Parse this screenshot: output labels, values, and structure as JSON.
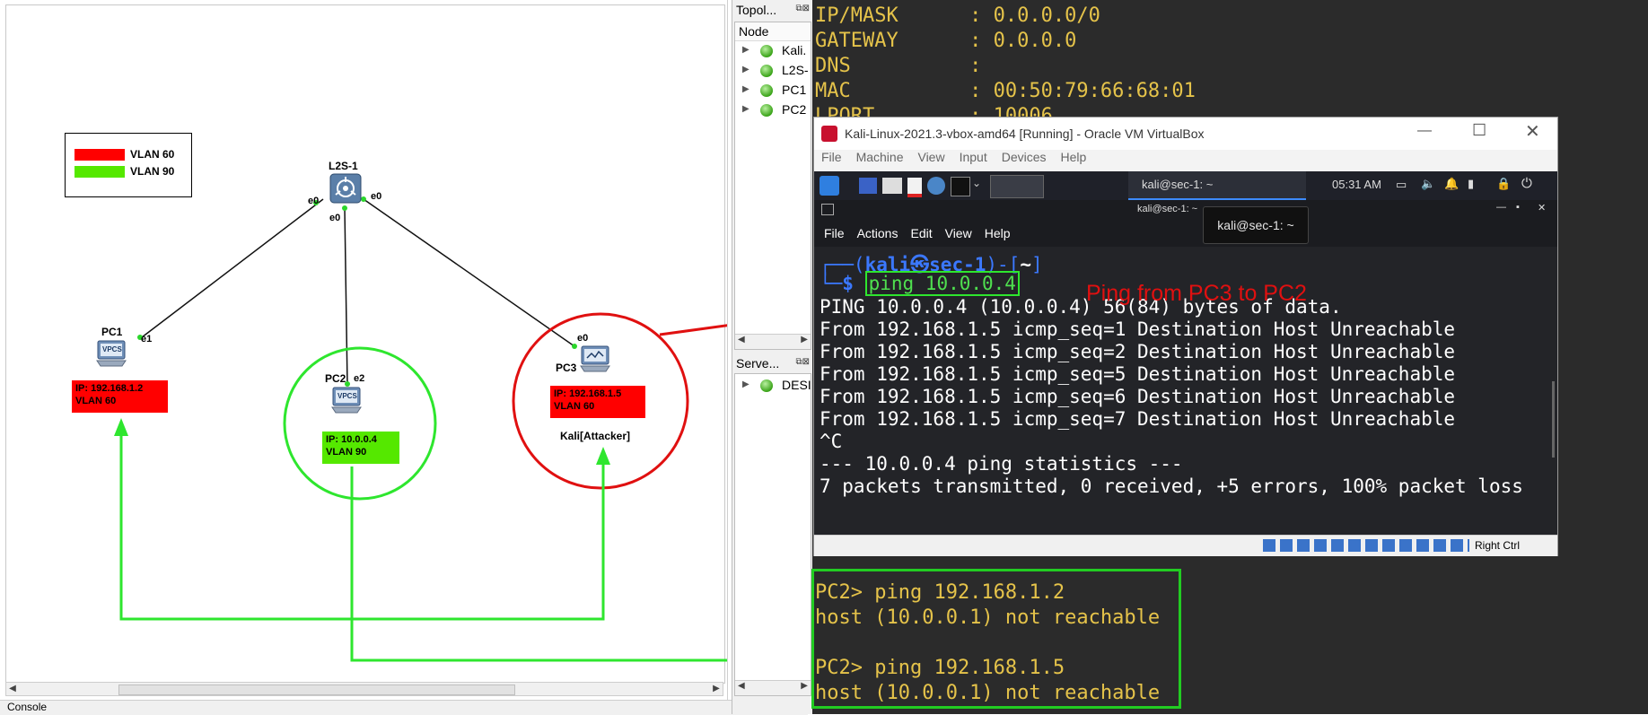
{
  "legend": [
    {
      "label": "VLAN 60",
      "color": "#ff0000"
    },
    {
      "label": "VLAN 90",
      "color": "#55e800"
    }
  ],
  "switch": {
    "name": "L2S-1",
    "ports": [
      "e0",
      "e0",
      "e0"
    ]
  },
  "pc1": {
    "name": "PC1",
    "port": "e1",
    "ip": "IP: 192.168.1.2",
    "vlan": "VLAN 60"
  },
  "pc2": {
    "name": "PC2",
    "port": "e2",
    "ip": "IP: 10.0.0.4",
    "vlan": "VLAN 90"
  },
  "pc3": {
    "name": "PC3",
    "port": "e0",
    "ip": "IP: 192.168.1.5",
    "vlan": "VLAN 60",
    "caption": "Kali[Attacker]"
  },
  "vpcs_label": "VPCS",
  "side": {
    "topology_title": "Topol...",
    "tree_header": "Node",
    "nodes": [
      "Kali.",
      "L2S-",
      "PC1",
      "PC2"
    ],
    "servers_title": "Serve...",
    "servers": [
      "DESI"
    ]
  },
  "console_label": "Console",
  "top_terminal": [
    "IP/MASK      : 0.0.0.0/0",
    "GATEWAY      : 0.0.0.0",
    "DNS          :",
    "MAC          : 00:50:79:66:68:01",
    "LPORT        : 10006"
  ],
  "vbox": {
    "title": "Kali-Linux-2021.3-vbox-amd64 [Running] - Oracle VM VirtualBox",
    "menu": [
      "File",
      "Machine",
      "View",
      "Input",
      "Devices",
      "Help"
    ],
    "task_title": "kali@sec-1: ~",
    "clock": "05:31 AM",
    "guest_title": "kali@sec-1: ~",
    "guest_menu": [
      "File",
      "Actions",
      "Edit",
      "View",
      "Help"
    ],
    "tooltip": "kali@sec-1: ~",
    "prompt_user": "kali",
    "prompt_host": "sec-1",
    "prompt_dir": "~",
    "command": "ping 10.0.0.4",
    "output": [
      "PING 10.0.0.4 (10.0.0.4) 56(84) bytes of data.",
      "From 192.168.1.5 icmp_seq=1 Destination Host Unreachable",
      "From 192.168.1.5 icmp_seq=2 Destination Host Unreachable",
      "From 192.168.1.5 icmp_seq=5 Destination Host Unreachable",
      "From 192.168.1.5 icmp_seq=6 Destination Host Unreachable",
      "From 192.168.1.5 icmp_seq=7 Destination Host Unreachable",
      "^C",
      "--- 10.0.0.4 ping statistics ---",
      "7 packets transmitted, 0 received, +5 errors, 100% packet loss"
    ],
    "status_right": "Right Ctrl"
  },
  "annotation": "Ping from PC3 to PC2",
  "pc2_console": [
    "PC2> ping 192.168.1.2",
    "host (10.0.0.1) not reachable",
    "",
    "PC2> ping 192.168.1.5",
    "host (10.0.0.1) not reachable"
  ],
  "colors": {
    "annotation_red": "#e01010",
    "highlight_green": "#22cc22",
    "terminal_yellow": "#e5c34a"
  }
}
